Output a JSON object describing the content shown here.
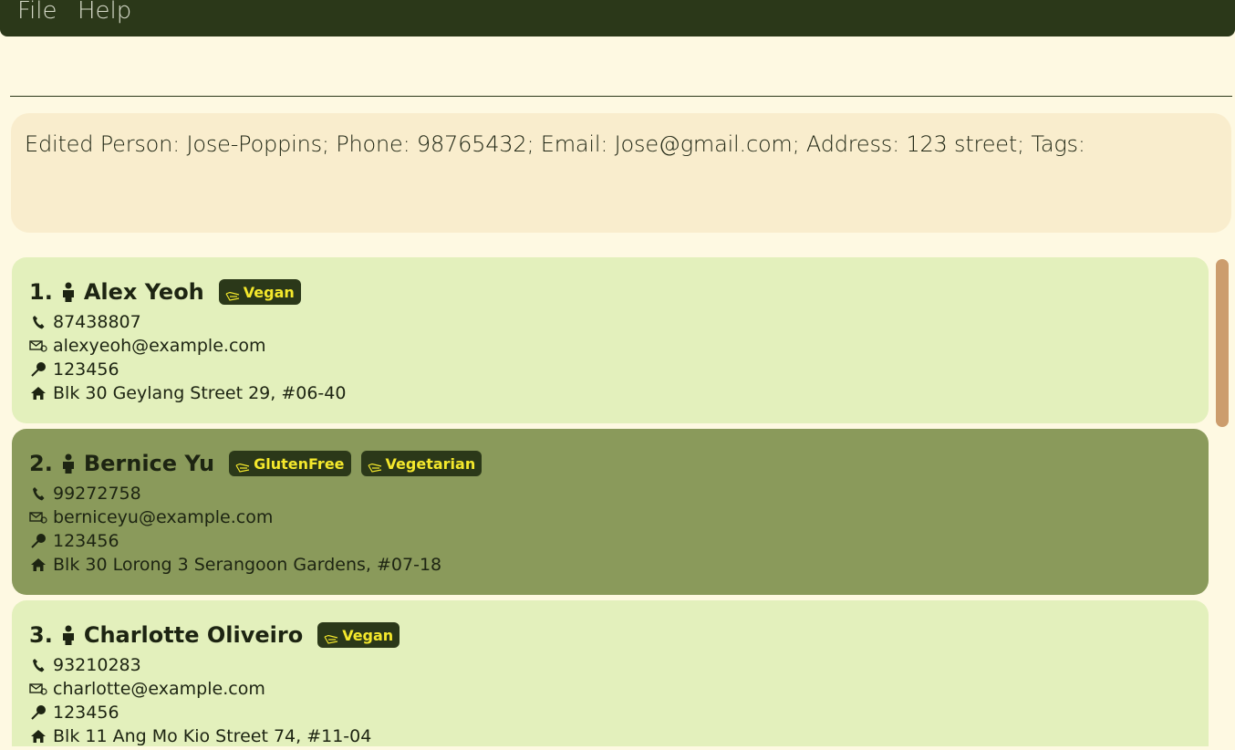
{
  "menu": {
    "file": "File",
    "help": "Help"
  },
  "command": {
    "value": ""
  },
  "result": {
    "text": "Edited Person: Jose-Poppins; Phone: 98765432; Email: Jose@gmail.com; Address: 123 street; Tags:"
  },
  "persons": [
    {
      "index": "1.",
      "name": "Alex Yeoh",
      "tags": [
        "Vegan"
      ],
      "phone": "87438807",
      "email": "alexyeoh@example.com",
      "pin": "123456",
      "address": "Blk 30 Geylang Street 29, #06-40",
      "selected": false
    },
    {
      "index": "2.",
      "name": "Bernice Yu",
      "tags": [
        "GlutenFree",
        "Vegetarian"
      ],
      "phone": "99272758",
      "email": "berniceyu@example.com",
      "pin": "123456",
      "address": "Blk 30 Lorong 3 Serangoon Gardens, #07-18",
      "selected": true
    },
    {
      "index": "3.",
      "name": "Charlotte Oliveiro",
      "tags": [
        "Vegan"
      ],
      "phone": "93210283",
      "email": "charlotte@example.com",
      "pin": "123456",
      "address": "Blk 11 Ang Mo Kio Street 74, #11-04",
      "selected": false
    }
  ],
  "icons": {
    "person": "person-icon",
    "tag": "tag-icon",
    "phone": "phone-icon",
    "email": "email-icon",
    "pin": "pin-icon",
    "address": "home-icon"
  },
  "colors": {
    "menubar": "#2b3819",
    "background": "#fef9e2",
    "result_box": "#f9edcd",
    "card": "#e3f0bc",
    "card_selected": "#8a9a5b",
    "tag_bg": "#2b3819",
    "tag_text": "#f4e82c",
    "scrollbar": "#cc9d6d"
  }
}
